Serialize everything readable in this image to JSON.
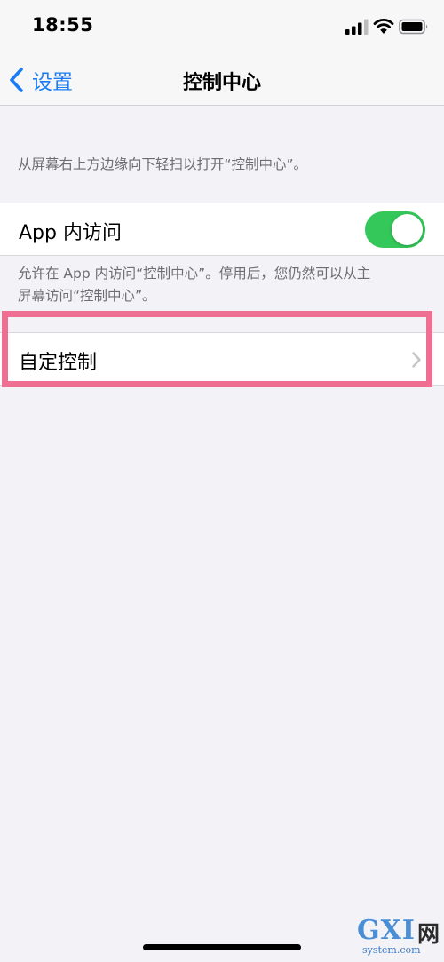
{
  "status_bar": {
    "time": "18:55",
    "icons": [
      "signal-icon",
      "wifi-icon",
      "battery-icon"
    ]
  },
  "nav": {
    "back_label": "设置",
    "title": "控制中心"
  },
  "sections": {
    "intro_footer": "从屏幕右上方边缘向下轻扫以打开“控制中心”。",
    "app_access": {
      "label": "App 内访问",
      "toggle_on": true,
      "footer_line1": "允许在 App 内访问“控制中心”。停用后，您仍然可以从主",
      "footer_line2": "屏幕访问“控制中心”。"
    },
    "customize": {
      "label": "自定控制"
    }
  },
  "watermark": {
    "logo": "GXI",
    "net": "网",
    "url": "system.com"
  },
  "colors": {
    "accent": "#1a7cf5",
    "toggle_on": "#34c759",
    "highlight": "#ef6f93",
    "background": "#f2f2f7"
  }
}
